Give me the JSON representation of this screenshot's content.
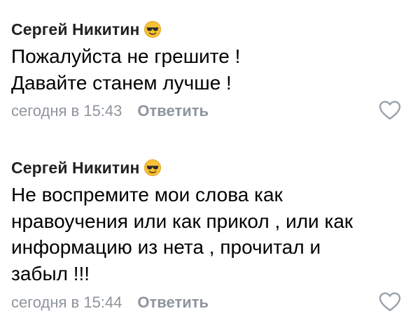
{
  "comments": [
    {
      "author": "Сергей Никитин",
      "author_icon": "sunglasses-emoji",
      "lines": [
        "Пожалуйста не грешите !",
        "Давайте станем лучше !"
      ],
      "timestamp": "сегодня в 15:43",
      "reply_label": "Ответить",
      "like_icon": "heart-outline-icon"
    },
    {
      "author": "Сергей Никитин",
      "author_icon": "sunglasses-emoji",
      "lines": [
        "Не воспремите мои слова как",
        "нравоучения или как прикол , или как",
        "информацию из нета , прочитал и",
        "забыл !!!"
      ],
      "timestamp": "сегодня в 15:44",
      "reply_label": "Ответить",
      "like_icon": "heart-outline-icon"
    }
  ],
  "colors": {
    "text": "#000000",
    "author": "#222222",
    "meta": "#8f959c",
    "emoji_face": "#f7c137",
    "icon_stroke": "#9aa1a9"
  }
}
